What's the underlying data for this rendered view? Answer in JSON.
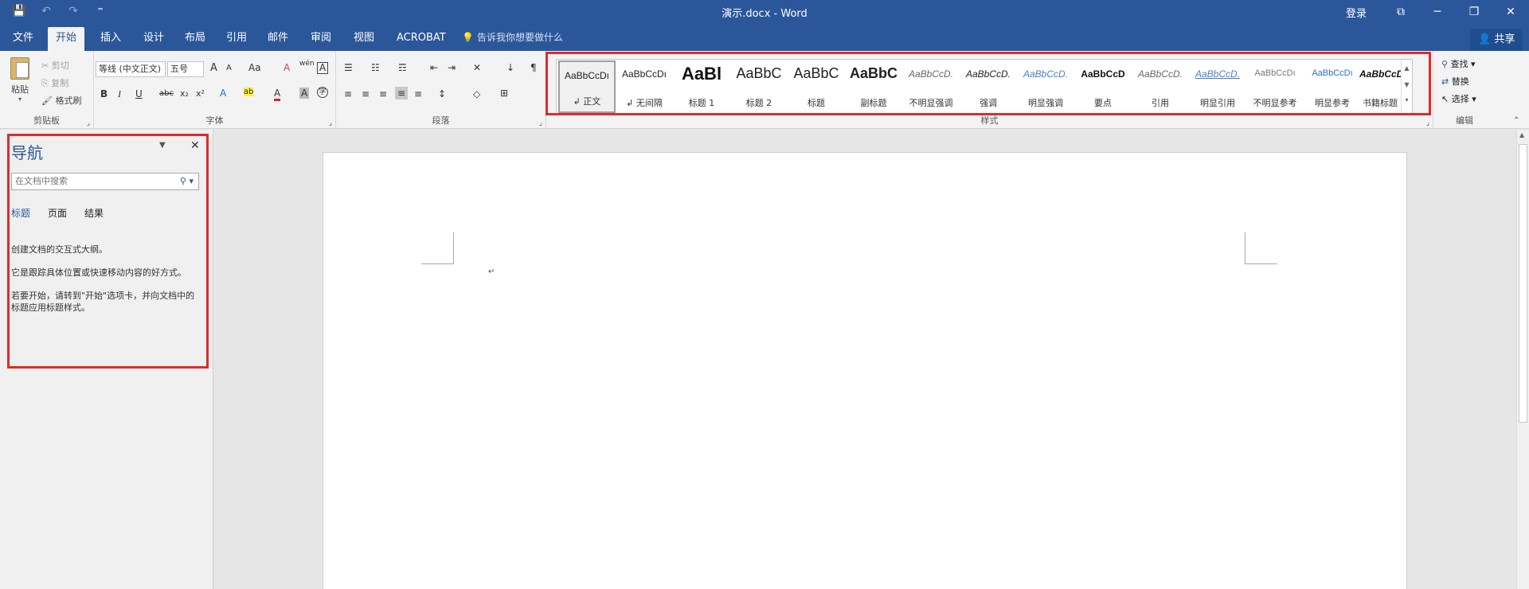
{
  "window": {
    "title": "演示.docx - Word",
    "login": "登录",
    "controls": {
      "ribbon_options": "⧉",
      "minimize": "─",
      "restore": "❐",
      "close": "✕"
    }
  },
  "qat": {
    "save": "💾",
    "undo": "↶",
    "redo": "↷",
    "customize": "⁼"
  },
  "tabs": [
    {
      "label": "文件"
    },
    {
      "label": "开始"
    },
    {
      "label": "插入"
    },
    {
      "label": "设计"
    },
    {
      "label": "布局"
    },
    {
      "label": "引用"
    },
    {
      "label": "邮件"
    },
    {
      "label": "审阅"
    },
    {
      "label": "视图"
    },
    {
      "label": "ACROBAT"
    }
  ],
  "tellme": {
    "icon": "💡",
    "text": "告诉我你想要做什么"
  },
  "share": {
    "icon": "👤",
    "label": "共享"
  },
  "clipboard": {
    "group_label": "剪贴板",
    "paste": "粘贴",
    "cut": "剪切",
    "copy": "复制",
    "format_painter": "格式刷"
  },
  "font": {
    "group_label": "字体",
    "font_name": "等线 (中文正文)",
    "font_size": "五号",
    "grow": "A",
    "shrink": "A",
    "change_case": "Aa",
    "clear": "A",
    "phonetic": "wén",
    "border_char": "A",
    "bold": "B",
    "italic": "I",
    "underline": "U",
    "strike": "abc",
    "subscript": "x₂",
    "superscript": "x²",
    "text_effects": "A",
    "highlight": "ab",
    "font_color": "A",
    "char_shading": "A",
    "enclose": "字"
  },
  "paragraph": {
    "group_label": "段落",
    "bullets": "☰",
    "numbering": "☷",
    "multilevel": "☶",
    "decrease_indent": "⇤",
    "increase_indent": "⇥",
    "chinese_layout": "✕",
    "sort": "↓",
    "show_marks": "¶",
    "align_left": "≡",
    "center": "≡",
    "align_right": "≡",
    "justify": "≡",
    "distributed": "≡",
    "line_spacing": "↕",
    "shading": "◇",
    "borders": "⊞"
  },
  "styles": {
    "group_label": "样式",
    "items": [
      {
        "sample": "AaBbCcDı",
        "name": "↲ 正文"
      },
      {
        "sample": "AaBbCcDı",
        "name": "↲ 无间隔"
      },
      {
        "sample": "AaBl",
        "name": "标题 1"
      },
      {
        "sample": "AaBbC",
        "name": "标题 2"
      },
      {
        "sample": "AaBbC",
        "name": "标题"
      },
      {
        "sample": "AaBbC",
        "name": "副标题"
      },
      {
        "sample": "AaBbCcD.",
        "name": "不明显强调"
      },
      {
        "sample": "AaBbCcD.",
        "name": "强调"
      },
      {
        "sample": "AaBbCcD.",
        "name": "明显强调"
      },
      {
        "sample": "AaBbCcD",
        "name": "要点"
      },
      {
        "sample": "AaBbCcD.",
        "name": "引用"
      },
      {
        "sample": "AaBbCcD.",
        "name": "明显引用"
      },
      {
        "sample": "AaBbCcDı",
        "name": "不明显参考"
      },
      {
        "sample": "AaBbCcDı",
        "name": "明显参考"
      },
      {
        "sample": "AaBbCcD",
        "name": "书籍标题"
      }
    ]
  },
  "editing": {
    "group_label": "编辑",
    "find": "查找",
    "replace": "替换",
    "select": "选择"
  },
  "navigation": {
    "title": "导航",
    "search_placeholder": "在文档中搜索",
    "tabs": [
      "标题",
      "页面",
      "结果"
    ],
    "help": [
      "创建文档的交互式大纲。",
      "它是跟踪具体位置或快速移动内容的好方式。",
      "若要开始，请转到\"开始\"选项卡，并向文档中的标题应用标题样式。"
    ]
  },
  "document": {
    "paragraph_mark": "↵"
  },
  "colors": {
    "accent": "#2b579a",
    "highlight_box": "#e02a2a"
  }
}
